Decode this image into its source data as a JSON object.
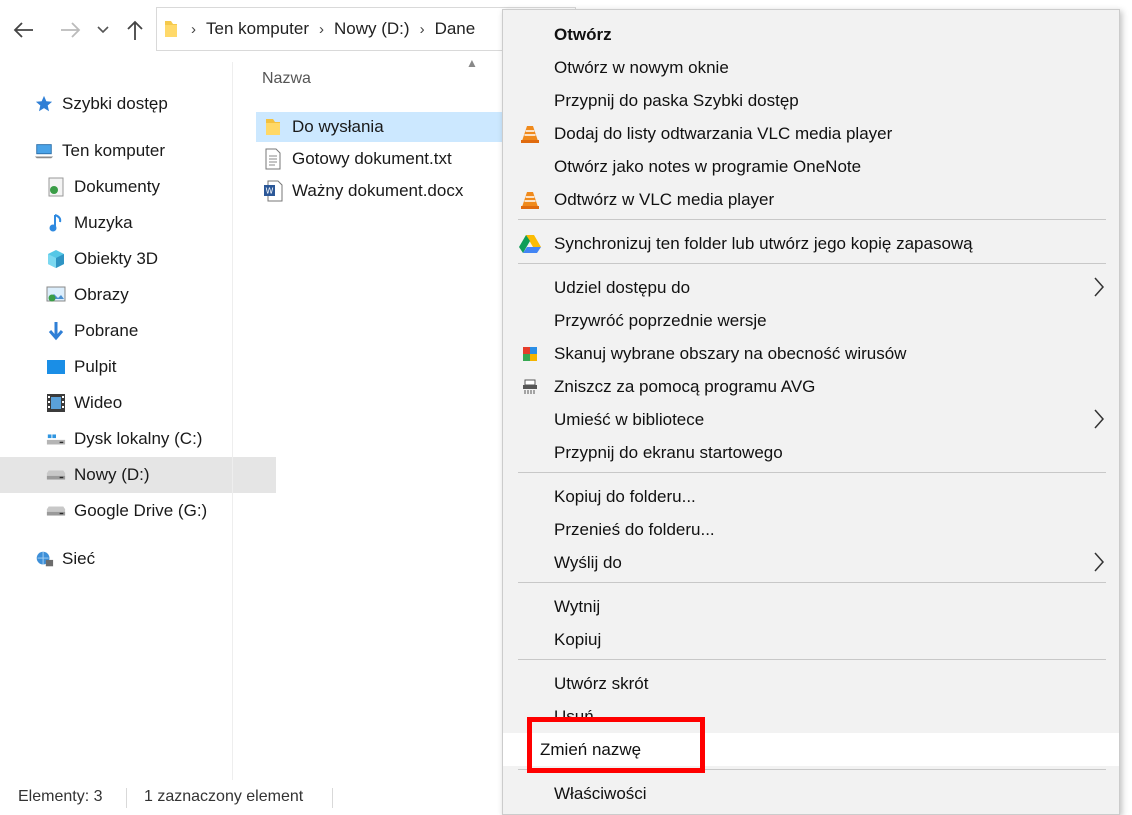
{
  "breadcrumb": [
    "Ten komputer",
    "Nowy (D:)",
    "Dane"
  ],
  "nav": {
    "items": [
      {
        "label": "Szybki dostęp",
        "icon": "star-icon"
      },
      {
        "label": "Ten komputer",
        "icon": "computer-icon"
      },
      {
        "label": "Dokumenty",
        "icon": "documents-icon"
      },
      {
        "label": "Muzyka",
        "icon": "music-icon"
      },
      {
        "label": "Obiekty 3D",
        "icon": "3d-objects-icon"
      },
      {
        "label": "Obrazy",
        "icon": "pictures-icon"
      },
      {
        "label": "Pobrane",
        "icon": "downloads-icon"
      },
      {
        "label": "Pulpit",
        "icon": "desktop-icon"
      },
      {
        "label": "Wideo",
        "icon": "video-icon"
      },
      {
        "label": "Dysk lokalny (C:)",
        "icon": "drive-icon"
      },
      {
        "label": "Nowy (D:)",
        "icon": "drive-icon"
      },
      {
        "label": "Google Drive (G:)",
        "icon": "drive-icon"
      },
      {
        "label": "Sieć",
        "icon": "network-icon"
      }
    ],
    "selected": "Nowy (D:)"
  },
  "filelist": {
    "column_name": "Nazwa",
    "files": [
      {
        "name": "Do wysłania",
        "icon": "folder-icon",
        "selected": true
      },
      {
        "name": "Gotowy dokument.txt",
        "icon": "text-file-icon",
        "selected": false
      },
      {
        "name": "Ważny dokument.docx",
        "icon": "word-file-icon",
        "selected": false
      }
    ]
  },
  "status": {
    "items_count": "Elementy: 3",
    "selected_count": "1 zaznaczony element"
  },
  "context_menu": {
    "items": [
      {
        "label": "Otwórz"
      },
      {
        "label": "Otwórz w nowym oknie"
      },
      {
        "label": "Przypnij do paska Szybki dostęp"
      },
      {
        "label": "Dodaj do listy odtwarzania VLC media player",
        "icon": "vlc-icon"
      },
      {
        "label": "Otwórz jako notes w programie OneNote"
      },
      {
        "label": "Odtwórz w VLC media player",
        "icon": "vlc-icon"
      },
      {
        "label": "Synchronizuj ten folder lub utwórz jego kopię zapasową",
        "icon": "google-drive-icon"
      },
      {
        "label": "Udziel dostępu do"
      },
      {
        "label": "Przywróć poprzednie wersje"
      },
      {
        "label": "Skanuj wybrane obszary na obecność wirusów",
        "icon": "avg-icon"
      },
      {
        "label": "Zniszcz za pomocą programu AVG",
        "icon": "shredder-icon"
      },
      {
        "label": "Umieść w bibliotece"
      },
      {
        "label": "Przypnij do ekranu startowego"
      },
      {
        "label": "Kopiuj do folderu..."
      },
      {
        "label": "Przenieś do folderu..."
      },
      {
        "label": "Wyślij do"
      },
      {
        "label": "Wytnij"
      },
      {
        "label": "Kopiuj"
      },
      {
        "label": "Utwórz skrót"
      },
      {
        "label": "Usuń"
      },
      {
        "label": "Zmień nazwę"
      },
      {
        "label": "Właściwości"
      }
    ],
    "hovered": "Zmień nazwę",
    "highlight_color": "#ff0000"
  },
  "colors": {
    "selection": "#cce8ff",
    "menu_bg": "#f2f2f2",
    "nav_selected": "#e5e5e5"
  }
}
